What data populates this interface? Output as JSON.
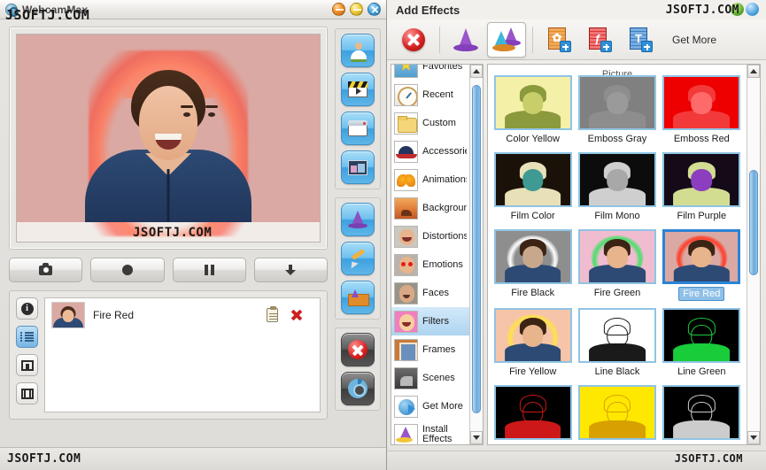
{
  "window": {
    "title": "WebcamMax",
    "app_icon": "webcam-icon",
    "controls": [
      {
        "name": "minimize-button",
        "color": "#f0922b"
      },
      {
        "name": "maximize-button",
        "color": "#f2cf3f"
      },
      {
        "name": "close-button",
        "color": "#49a6dd"
      }
    ],
    "statusbar_text": "JSOFTJ.COM"
  },
  "watermarks": {
    "title_overlay": "JSOFTJ.COM",
    "sidebar_overlay": "JSOFTJ.COM",
    "panel_top": "JSOFTJ.COM",
    "panel_bottom": "JSOFTJ.COM",
    "statusbar": "JSOFTJ.COM"
  },
  "preview": {
    "label": "webcam-preview",
    "effect_applied": "Fire Red",
    "bg_color": "#dba9a3",
    "glow_color": "#ff3c28",
    "shirt_color": "#2d4a74"
  },
  "transport": {
    "buttons": [
      {
        "name": "snapshot-button",
        "icon": "camera-icon"
      },
      {
        "name": "record-button",
        "icon": "record-circle-icon"
      },
      {
        "name": "pause-button",
        "icon": "pause-icon"
      },
      {
        "name": "save-button",
        "icon": "download-arrow-icon"
      }
    ]
  },
  "view_modes": [
    {
      "name": "info-view-button",
      "icon": "info-icon",
      "selected": false
    },
    {
      "name": "list-view-button",
      "icon": "list-icon",
      "selected": true
    },
    {
      "name": "picture-view-button",
      "icon": "picture-icon",
      "selected": false
    },
    {
      "name": "film-view-button",
      "icon": "film-icon",
      "selected": false
    }
  ],
  "active_effects": [
    {
      "name": "Fire Red",
      "settings_icon": "clipboard-icon",
      "remove_icon": "red-x-icon"
    }
  ],
  "side_toolbar": {
    "groups": [
      [
        {
          "name": "webcam-source-button",
          "icon": "person-webcam-icon"
        },
        {
          "name": "video-clip-button",
          "icon": "clapperboard-icon"
        },
        {
          "name": "desktop-window-button",
          "icon": "window-icon"
        },
        {
          "name": "gallery-button",
          "icon": "gallery-icon"
        }
      ],
      [
        {
          "name": "effects-button",
          "icon": "wizard-hat-icon"
        },
        {
          "name": "doodle-button",
          "icon": "pencil-icon"
        },
        {
          "name": "effects-box-button",
          "icon": "effects-box-icon"
        }
      ],
      [
        {
          "name": "stop-button",
          "icon": "red-x-circle-icon"
        },
        {
          "name": "settings-button",
          "icon": "gear-icon"
        }
      ]
    ]
  },
  "effects_panel": {
    "title": "Add Effects",
    "toolbar": [
      {
        "name": "remove-all-effects-button",
        "icon": "red-x-circle-icon",
        "selected": false
      },
      {
        "name": "effects-button",
        "icon": "purple-wizard-hat-icon",
        "selected": false
      },
      {
        "name": "all-effects-button",
        "icon": "double-wizard-hat-icon",
        "selected": true
      },
      {
        "name": "add-picture-button",
        "icon": "add-image-icon",
        "selected": false
      },
      {
        "name": "add-flash-button",
        "icon": "add-flash-icon",
        "selected": false
      },
      {
        "name": "add-text-button",
        "icon": "add-text-icon",
        "selected": false
      }
    ],
    "get_more_label": "Get More",
    "categories": [
      {
        "label": "Favorites",
        "icon": "star-icon",
        "selected": false
      },
      {
        "label": "Recent",
        "icon": "clock-icon",
        "selected": false
      },
      {
        "label": "Custom",
        "icon": "folder-icon",
        "selected": false
      },
      {
        "label": "Accessories",
        "icon": "cap-icon",
        "selected": false
      },
      {
        "label": "Animations",
        "icon": "butterfly-icon",
        "selected": false
      },
      {
        "label": "Background",
        "icon": "desert-icon",
        "selected": false
      },
      {
        "label": "Distortions",
        "icon": "distorted-face-icon",
        "selected": false
      },
      {
        "label": "Emotions",
        "icon": "red-eyes-face-icon",
        "selected": false
      },
      {
        "label": "Faces",
        "icon": "face-icon",
        "selected": false
      },
      {
        "label": "Filters",
        "icon": "pink-face-icon",
        "selected": true
      },
      {
        "label": "Frames",
        "icon": "frame-icon",
        "selected": false
      },
      {
        "label": "Scenes",
        "icon": "scene-icon",
        "selected": false
      },
      {
        "label": "Get More",
        "icon": "globe-icon",
        "selected": false
      },
      {
        "label": "Install Effects",
        "icon": "install-hat-icon",
        "selected": false
      }
    ],
    "cut_top_label": "Picture",
    "effects": [
      [
        {
          "label": "Color Yellow",
          "bg": "#f5f0a8",
          "subject": "#8a9a3c",
          "face": "#c8cf6a",
          "selected": false,
          "style": "solid"
        },
        {
          "label": "Emboss Gray",
          "bg": "#808080",
          "subject": "#8d8d8d",
          "face": "#9a9a9a",
          "selected": false,
          "style": "emboss"
        },
        {
          "label": "Emboss Red",
          "bg": "#ee0000",
          "subject": "#f23a3a",
          "face": "#ff6a6a",
          "selected": false,
          "style": "emboss"
        }
      ],
      [
        {
          "label": "Film Color",
          "bg": "#1a1208",
          "subject": "#e8e0b8",
          "face": "#3e9a92",
          "selected": false,
          "style": "film"
        },
        {
          "label": "Film Mono",
          "bg": "#0c0c0c",
          "subject": "#cfcfcf",
          "face": "#a8a8a8",
          "selected": false,
          "style": "film"
        },
        {
          "label": "Film Purple",
          "bg": "#140a18",
          "subject": "#d2dd92",
          "face": "#8b3fbe",
          "selected": false,
          "style": "film"
        }
      ],
      [
        {
          "label": "Fire Black",
          "bg": "#8e8e8e",
          "subject": "#2d4a74",
          "face": "#c8a88c",
          "selected": false,
          "style": "fire",
          "glow": "#ffffff"
        },
        {
          "label": "Fire Green",
          "bg": "#f0bcd0",
          "subject": "#2d4a74",
          "face": "#e8b48c",
          "selected": false,
          "style": "fire",
          "glow": "#49e06a"
        },
        {
          "label": "Fire Red",
          "bg": "#dba9a3",
          "subject": "#2d4a74",
          "face": "#e8b48c",
          "selected": true,
          "style": "fire",
          "glow": "#ff3c28"
        }
      ],
      [
        {
          "label": "Fire Yellow",
          "bg": "#f6c4a8",
          "subject": "#2d4a74",
          "face": "#e8b48c",
          "selected": false,
          "style": "fire",
          "glow": "#ffe24a"
        },
        {
          "label": "Line Black",
          "bg": "#ffffff",
          "subject": "#1a1a1a",
          "face": "#ffffff",
          "selected": false,
          "style": "line"
        },
        {
          "label": "Line Green",
          "bg": "#000000",
          "subject": "#18cc3a",
          "face": "#000000",
          "selected": false,
          "style": "line"
        }
      ],
      [
        {
          "label": "",
          "bg": "#000000",
          "subject": "#cc1818",
          "face": "#000000",
          "selected": false,
          "style": "line"
        },
        {
          "label": "",
          "bg": "#ffe800",
          "subject": "#d8a000",
          "face": "#ffe800",
          "selected": false,
          "style": "line"
        },
        {
          "label": "",
          "bg": "#000000",
          "subject": "#cccccc",
          "face": "#000000",
          "selected": false,
          "style": "line"
        }
      ]
    ],
    "category_scroll": {
      "thumb_top_pct": 2,
      "thumb_height_pct": 93
    },
    "grid_scroll": {
      "thumb_top_pct": 26,
      "thumb_height_pct": 30
    }
  }
}
